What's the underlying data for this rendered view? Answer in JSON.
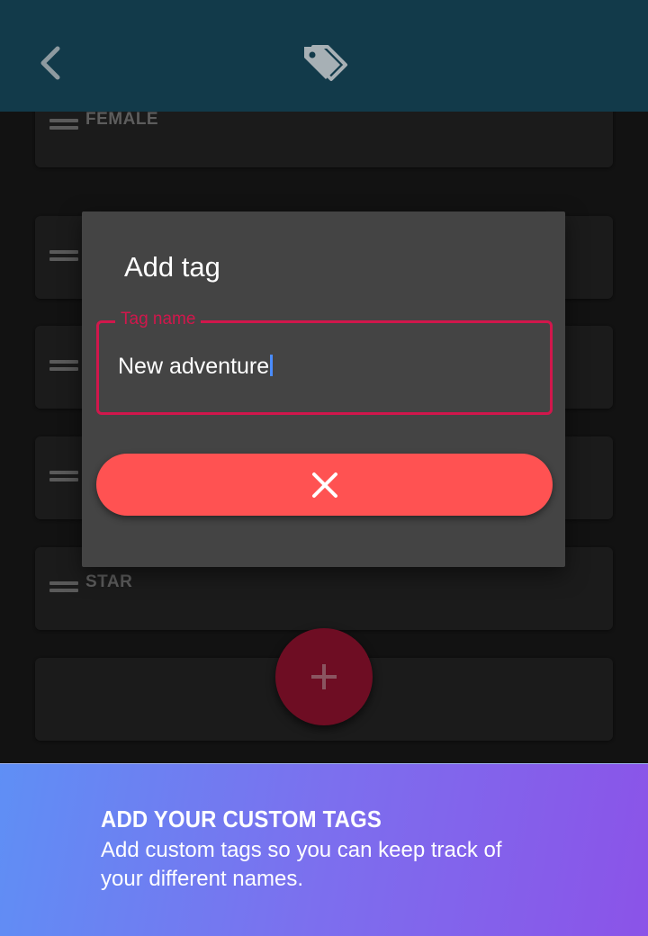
{
  "app_bar": {
    "back_icon": "chevron-left-icon",
    "logo_icon": "tags-icon",
    "background": "#123a4a"
  },
  "tag_list": {
    "items": [
      {
        "label": "FEMALE"
      },
      {
        "label": ""
      },
      {
        "label": ""
      },
      {
        "label": ""
      },
      {
        "label": "STAR"
      },
      {
        "label": ""
      }
    ]
  },
  "fab": {
    "icon": "plus-icon",
    "color": "#6e0d23"
  },
  "dialog": {
    "title": "Add tag",
    "field_label": "Tag name",
    "field_value": "New adventure",
    "cancel_icon": "close-icon",
    "accent": "#d1174c",
    "cancel_color": "#ff5252"
  },
  "promo": {
    "title": "ADD YOUR CUSTOM TAGS",
    "body": "Add custom tags so you can keep track of your different names."
  }
}
